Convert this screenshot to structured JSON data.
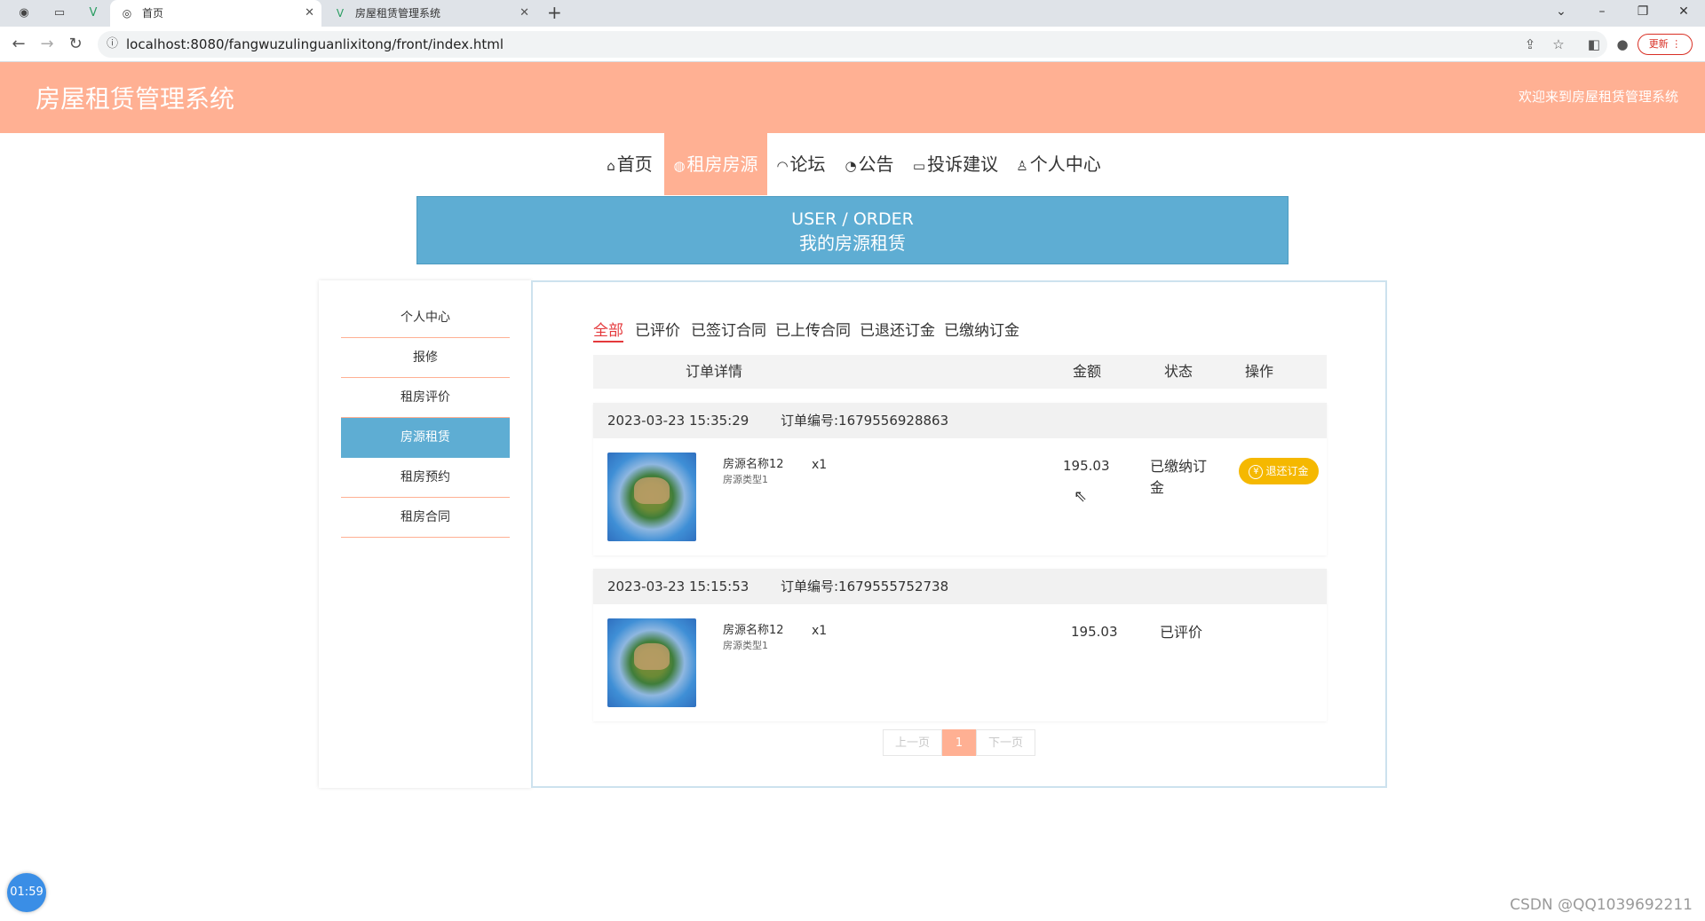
{
  "browser": {
    "tabs": [
      {
        "title": "首页",
        "active": true
      },
      {
        "title": "房屋租赁管理系统",
        "active": false
      }
    ],
    "url": "localhost:8080/fangwuzulinguanlixitong/front/index.html",
    "update_label": "更新"
  },
  "header": {
    "title": "房屋租赁管理系统",
    "welcome": "欢迎来到房屋租赁管理系统",
    "bg_color": "#ffb093"
  },
  "nav": [
    {
      "icon": "⌂",
      "icon_name": "home-icon",
      "label": "首页"
    },
    {
      "icon": "◍",
      "icon_name": "globe-icon",
      "label": "租房房源",
      "active": true
    },
    {
      "icon": "◠",
      "icon_name": "forum-icon",
      "label": "论坛"
    },
    {
      "icon": "◔",
      "icon_name": "notice-icon",
      "label": "公告"
    },
    {
      "icon": "▭",
      "icon_name": "complaint-icon",
      "label": "投诉建议"
    },
    {
      "icon": "♙",
      "icon_name": "user-icon",
      "label": "个人中心"
    }
  ],
  "banner": {
    "en": "USER / ORDER",
    "cn": "我的房源租赁",
    "color": "#5eadd3"
  },
  "sidebar": [
    {
      "label": "个人中心"
    },
    {
      "label": "报修"
    },
    {
      "label": "租房评价"
    },
    {
      "label": "房源租赁",
      "active": true
    },
    {
      "label": "租房预约"
    },
    {
      "label": "租房合同"
    }
  ],
  "status_tabs": [
    "全部",
    "已评价",
    "已签订合同",
    "已上传合同",
    "已退还订金",
    "已缴纳订金"
  ],
  "table": {
    "headers": {
      "detail": "订单详情",
      "amount": "金额",
      "status": "状态",
      "action": "操作"
    }
  },
  "orders": [
    {
      "time": "2023-03-23 15:35:29",
      "order_no": "订单编号:1679556928863",
      "name": "房源名称12",
      "type": "房源类型1",
      "qty": "x1",
      "amount": "195.03",
      "status": "已缴纳订金",
      "action": "退还订金"
    },
    {
      "time": "2023-03-23 15:15:53",
      "order_no": "订单编号:1679555752738",
      "name": "房源名称12",
      "type": "房源类型1",
      "qty": "x1",
      "amount": "195.03",
      "status": "已评价",
      "action": ""
    }
  ],
  "pager": {
    "prev": "上一页",
    "current": "1",
    "next": "下一页"
  },
  "timer": "01:59",
  "watermark": "CSDN @QQ1039692211"
}
